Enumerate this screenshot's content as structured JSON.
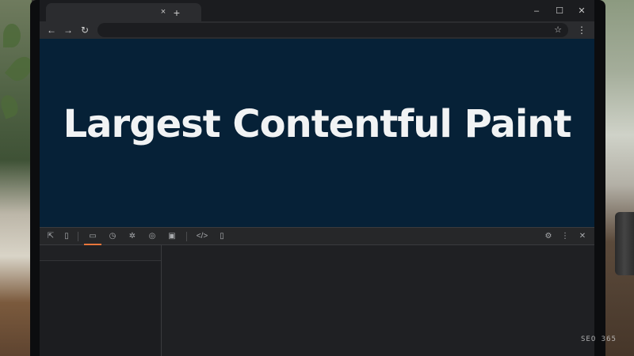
{
  "page": {
    "hero_text": "Largest Contentful Paint",
    "background_color": "#062137"
  },
  "browser": {
    "tab": {
      "title": "",
      "close_icon": "×"
    },
    "new_tab_icon": "+",
    "window_controls": {
      "minimize": "–",
      "maximize": "☐",
      "close": "✕"
    },
    "toolbar": {
      "back_icon": "←",
      "forward_icon": "→",
      "reload_icon": "↻",
      "address_value": "",
      "bookmark_icon": "☆",
      "menu_icon": "⋮"
    }
  },
  "devtools": {
    "icons": [
      {
        "name": "inspect-element-icon",
        "glyph": "⇱"
      },
      {
        "name": "device-toolbar-icon",
        "glyph": "▯"
      },
      {
        "name": "elements-tab-icon",
        "glyph": "▭"
      },
      {
        "name": "performance-tab-icon",
        "glyph": "◷"
      },
      {
        "name": "sources-tab-icon",
        "glyph": "✲"
      },
      {
        "name": "network-tab-icon",
        "glyph": "◎"
      },
      {
        "name": "lighthouse-tab-icon",
        "glyph": "▣"
      },
      {
        "name": "console-tab-icon",
        "glyph": "</>"
      },
      {
        "name": "application-tab-icon",
        "glyph": "▯"
      }
    ],
    "settings_icon": "⚙",
    "more_icon": "⋮",
    "close_icon": "✕",
    "accent_color": "#e8763b"
  },
  "watermark": "SEO 365"
}
